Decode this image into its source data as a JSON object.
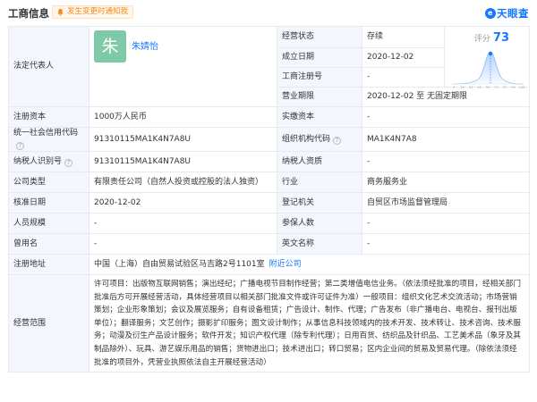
{
  "header": {
    "title": "工商信息",
    "notice": "发生变更时通知我",
    "logo_text": "天眼查",
    "logo_mark": "e"
  },
  "legal_rep": {
    "label": "法定代表人",
    "avatar_char": "朱",
    "name": "朱婧怡"
  },
  "score": {
    "label": "评分",
    "value": "73",
    "axis_ticks": [
      "0",
      "19",
      "33",
      "46",
      "59",
      "73",
      "87",
      "99",
      "100"
    ]
  },
  "rows": {
    "status": {
      "label": "经营状态",
      "value": "存续"
    },
    "established": {
      "label": "成立日期",
      "value": "2020-12-02"
    },
    "reg_no": {
      "label": "工商注册号",
      "value": "-"
    },
    "term": {
      "label": "营业期限",
      "value": "2020-12-02  至  无固定期限"
    },
    "reg_capital": {
      "label": "注册资本",
      "value": "1000万人民币"
    },
    "paid_capital": {
      "label": "实缴资本",
      "value": "-"
    },
    "credit_code": {
      "label": "统一社会信用代码",
      "value": "91310115MA1K4N7A8U"
    },
    "org_code": {
      "label": "组织机构代码",
      "value": "MA1K4N7A8"
    },
    "taxpayer_id": {
      "label": "纳税人识别号",
      "value": "91310115MA1K4N7A8U"
    },
    "taxpayer_qual": {
      "label": "纳税人资质",
      "value": "-"
    },
    "company_type": {
      "label": "公司类型",
      "value": "有限责任公司（自然人投资或控股的法人独资）"
    },
    "industry": {
      "label": "行业",
      "value": "商务服务业"
    },
    "approval_date": {
      "label": "核准日期",
      "value": "2020-12-02"
    },
    "reg_authority": {
      "label": "登记机关",
      "value": "自贸区市场监督管理局"
    },
    "staff_size": {
      "label": "人员规模",
      "value": "-"
    },
    "insured": {
      "label": "参保人数",
      "value": "-"
    },
    "former_name": {
      "label": "曾用名",
      "value": "-"
    },
    "english_name": {
      "label": "英文名称",
      "value": "-"
    },
    "address": {
      "label": "注册地址",
      "value": "中国（上海）自由贸易试验区马吉路2号1101室",
      "link": "附近公司"
    },
    "scope": {
      "label": "经营范围",
      "value": "许可项目：出版物互联网销售；演出经纪；广播电视节目制作经营；第二类增值电信业务。（依法须经批准的项目，经相关部门批准后方可开展经营活动，具体经营项目以相关部门批准文件或许可证件为准）一般项目：组织文化艺术交流活动；市场营销策划；企业形象策划；会议及展览服务；自有设备租赁；广告设计、制作、代理；广告发布（非广播电台、电视台、报刊出版单位）；翻译服务；文艺创作；摄影扩印服务；图文设计制作；从事信息科技领域内的技术开发、技术转让、技术咨询、技术服务；动漫及衍生产品设计服务；软件开发；知识产权代理（除专利代理）；日用百货、纺织品及针织品、工艺美术品（象牙及其制品除外）、玩具、游艺娱乐用品的销售；货物进出口；技术进出口；转口贸易；区内企业间的贸易及贸易代理。（除依法须经批准的项目外，凭营业执照依法自主开展经营活动）"
    }
  },
  "colors": {
    "accent": "#1677ff",
    "label_bg": "#f3f6fc",
    "border": "#e6eaf0",
    "notice_orange": "#f08c1e",
    "avatar_green": "#7ec9a7"
  }
}
